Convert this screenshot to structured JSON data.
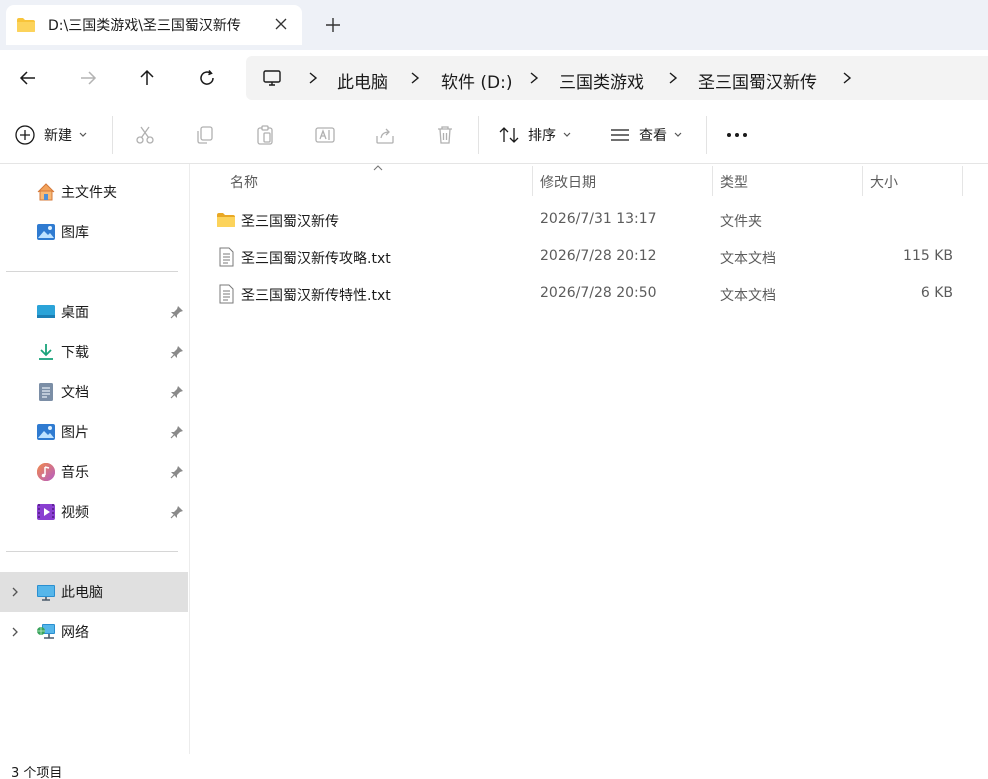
{
  "tab": {
    "title": "D:\\三国类游戏\\圣三国蜀汉新传",
    "icon": "folder-icon"
  },
  "breadcrumb": [
    "此电脑",
    "软件 (D:)",
    "三国类游戏",
    "圣三国蜀汉新传"
  ],
  "toolbar": {
    "new_label": "新建",
    "sort_label": "排序",
    "view_label": "查看"
  },
  "sidebar": {
    "quick": [
      {
        "label": "主文件夹",
        "icon": "home-icon"
      },
      {
        "label": "图库",
        "icon": "gallery-icon"
      }
    ],
    "pinned": [
      {
        "label": "桌面",
        "icon": "desktop-icon"
      },
      {
        "label": "下载",
        "icon": "download-icon"
      },
      {
        "label": "文档",
        "icon": "documents-icon"
      },
      {
        "label": "图片",
        "icon": "pictures-icon"
      },
      {
        "label": "音乐",
        "icon": "music-icon"
      },
      {
        "label": "视频",
        "icon": "videos-icon"
      }
    ],
    "locations": [
      {
        "label": "此电脑",
        "icon": "this-pc-icon",
        "selected": true
      },
      {
        "label": "网络",
        "icon": "network-icon"
      }
    ]
  },
  "columns": {
    "name": "名称",
    "date": "修改日期",
    "type": "类型",
    "size": "大小"
  },
  "files": [
    {
      "name": "圣三国蜀汉新传",
      "date": "2026/7/31 13:17",
      "type": "文件夹",
      "size": "",
      "icon": "folder-icon"
    },
    {
      "name": "圣三国蜀汉新传攻略.txt",
      "date": "2026/7/28 20:12",
      "type": "文本文档",
      "size": "115 KB",
      "icon": "text-file-icon"
    },
    {
      "name": "圣三国蜀汉新传特性.txt",
      "date": "2026/7/28 20:50",
      "type": "文本文档",
      "size": "6 KB",
      "icon": "text-file-icon"
    }
  ],
  "status": "3 个项目",
  "colors": {
    "tabbar_bg": "#eef1f7",
    "folder": "#f8c43a",
    "selected_bg": "#e0e0e0"
  }
}
